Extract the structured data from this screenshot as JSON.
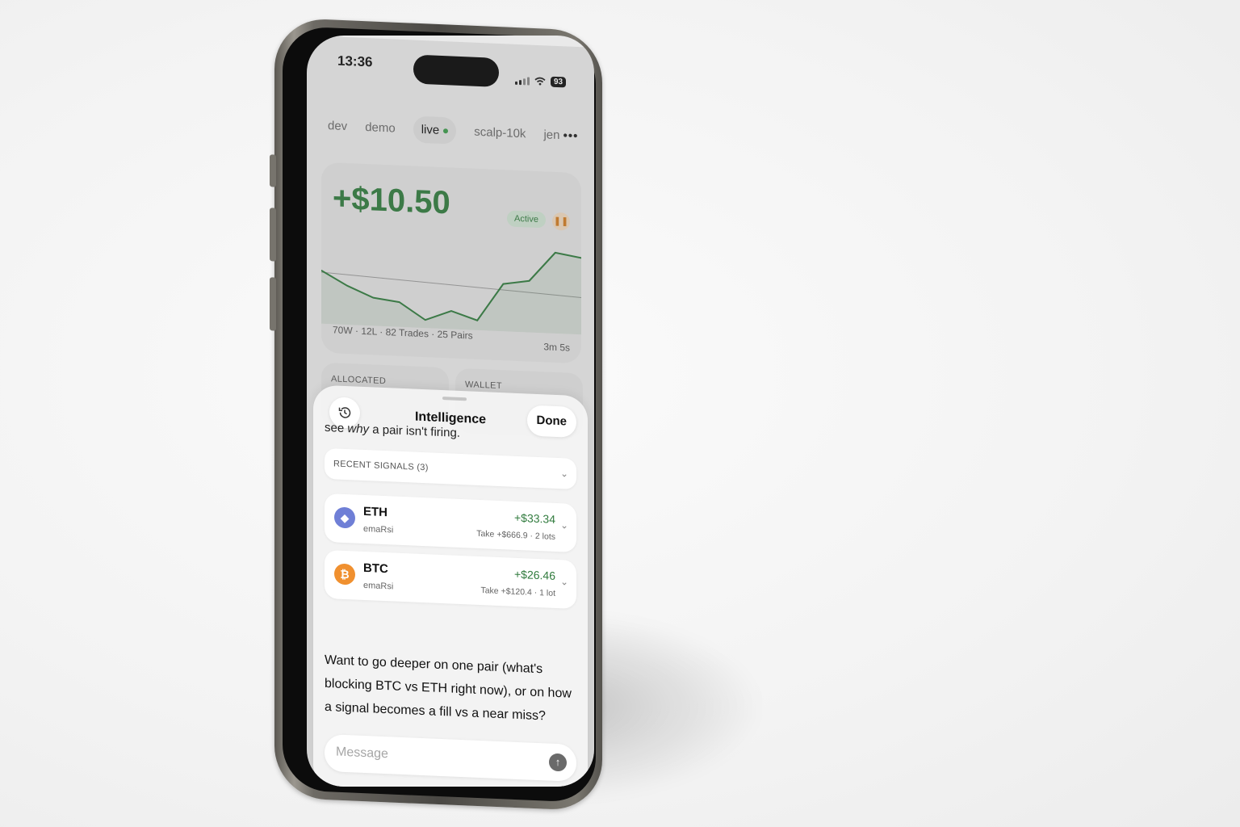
{
  "status_bar": {
    "time": "13:36",
    "battery": "93"
  },
  "tabs": [
    {
      "label": "dev"
    },
    {
      "label": "demo"
    },
    {
      "label": "live"
    },
    {
      "label": "scalp-10k"
    },
    {
      "label": "jen"
    }
  ],
  "tabs_more": "•••",
  "performance": {
    "pnl": "+$10.50",
    "status": "Active",
    "pause_icon": "pause-icon",
    "stats": "70W · 12L · 82 Trades · 25 Pairs",
    "duration": "3m 5s"
  },
  "cards": {
    "allocated_label": "ALLOCATED",
    "wallet_label": "WALLET"
  },
  "intelligence": {
    "title": "Intelligence",
    "done_label": "Done",
    "history_icon": "history-icon",
    "intro_before": "see ",
    "intro_em": "why",
    "intro_after": " a pair isn't firing.",
    "recent_signals_label": "RECENT SIGNALS (3)",
    "signals": [
      {
        "coin": "ETH",
        "strategy": "emaRsi",
        "pnl": "+$33.34",
        "detail": "Take +$666.9 · 2 lots",
        "icon": "ethereum-icon",
        "color": "#6f7fd6"
      },
      {
        "coin": "BTC",
        "strategy": "emaRsi",
        "pnl": "+$26.46",
        "detail": "Take +$120.4 · 1 lot",
        "icon": "bitcoin-icon",
        "color": "#f0902f"
      }
    ],
    "reply": "Want to go deeper on one pair (what's blocking BTC vs ETH right now), or on how a signal becomes a fill vs a near miss?",
    "message_placeholder": "Message",
    "send_icon": "send-icon"
  },
  "colors": {
    "accent_green": "#2f7a3c",
    "warning_orange": "#d07a20"
  },
  "chart_data": {
    "type": "line",
    "x": [
      0,
      1,
      2,
      3,
      4,
      5,
      6,
      7,
      8,
      9,
      10
    ],
    "values": [
      0.2,
      -1.5,
      -2.8,
      -3.2,
      -5.2,
      -4.0,
      -5.0,
      -0.5,
      0.0,
      3.5,
      3.0
    ],
    "baseline": 0
  }
}
